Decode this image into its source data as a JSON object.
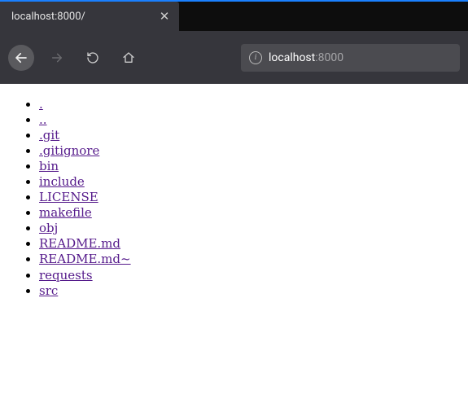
{
  "tab": {
    "title": "localhost:8000/",
    "close_glyph": "✕"
  },
  "url_bar": {
    "info_glyph": "i",
    "host": "localhost",
    "port": ":8000"
  },
  "listing": {
    "items": [
      {
        "name": "."
      },
      {
        "name": ".."
      },
      {
        "name": ".git"
      },
      {
        "name": ".gitignore"
      },
      {
        "name": "bin"
      },
      {
        "name": "include"
      },
      {
        "name": "LICENSE"
      },
      {
        "name": "makefile"
      },
      {
        "name": "obj"
      },
      {
        "name": "README.md"
      },
      {
        "name": "README.md~"
      },
      {
        "name": "requests"
      },
      {
        "name": "src"
      }
    ]
  }
}
